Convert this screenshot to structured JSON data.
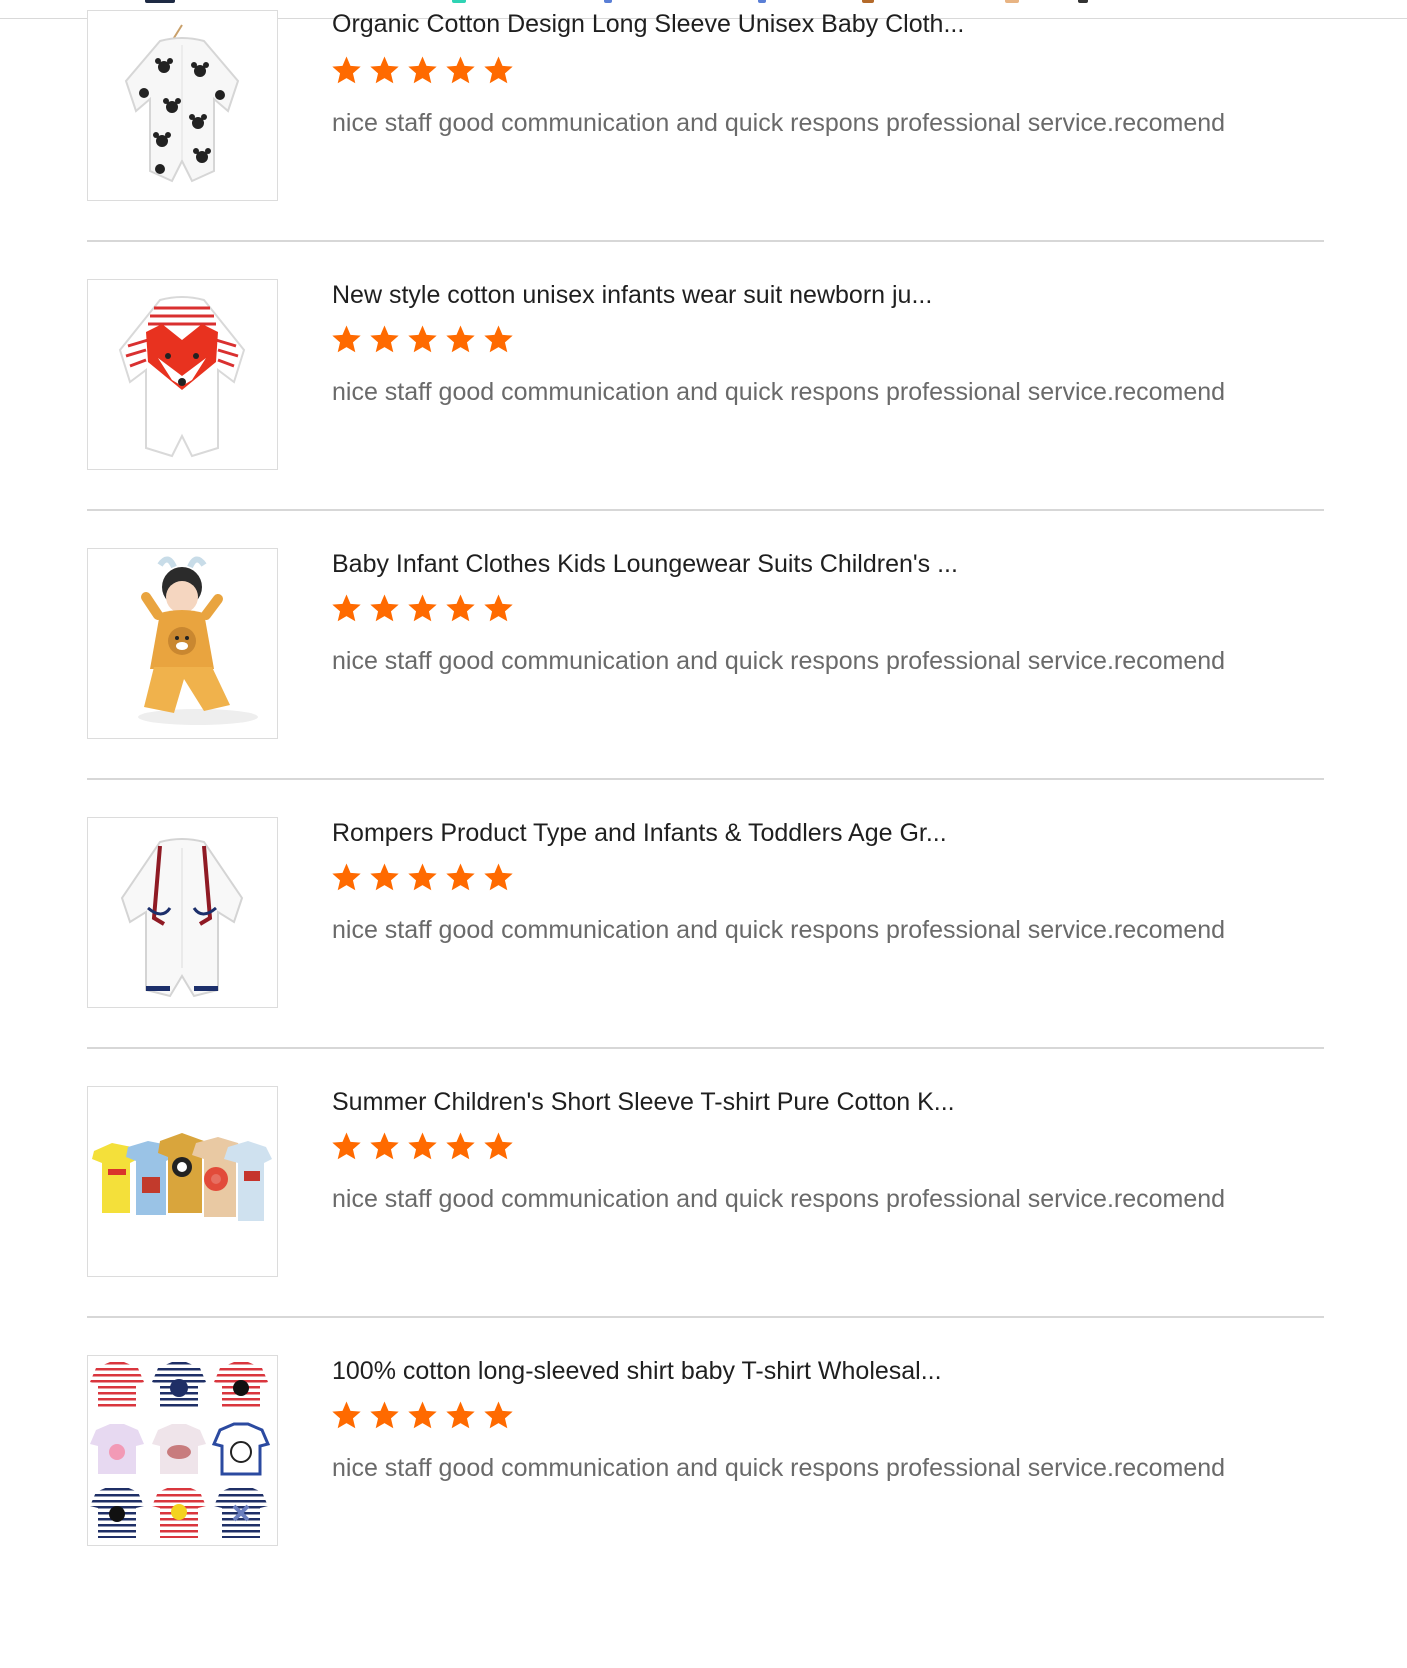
{
  "colors": {
    "star": "#ff6a00",
    "title_text": "#1f1f1f",
    "review_text": "#6a6a6a",
    "divider": "#d7d7d7"
  },
  "reviews": [
    {
      "product_title": "Organic Cotton Design Long Sleeve Unisex Baby Cloth...",
      "rating_stars": 5,
      "comment": "nice staff good communication and quick respons professional service.recomend",
      "thumbnail": "mickey-print-romper"
    },
    {
      "product_title": "New style cotton unisex infants wear suit newborn ju...",
      "rating_stars": 5,
      "comment": "nice staff good communication and quick respons professional service.recomend",
      "thumbnail": "fox-striped-romper"
    },
    {
      "product_title": "Baby Infant Clothes Kids Loungewear Suits Children's ...",
      "rating_stars": 5,
      "comment": "nice staff good communication and quick respons professional service.recomend",
      "thumbnail": "child-bear-loungewear"
    },
    {
      "product_title": "Rompers Product Type and Infants & Toddlers Age Gr...",
      "rating_stars": 5,
      "comment": "nice staff good communication and quick respons professional service.recomend",
      "thumbnail": "white-suspender-romper"
    },
    {
      "product_title": "Summer Children's Short Sleeve T-shirt Pure Cotton K...",
      "rating_stars": 5,
      "comment": "nice staff good communication and quick respons professional service.recomend",
      "thumbnail": "kids-tshirt-collection"
    },
    {
      "product_title": "100% cotton long-sleeved shirt baby T-shirt Wholesal...",
      "rating_stars": 5,
      "comment": "nice staff good communication and quick respons professional service.recomend",
      "thumbnail": "striped-tshirt-grid"
    }
  ]
}
